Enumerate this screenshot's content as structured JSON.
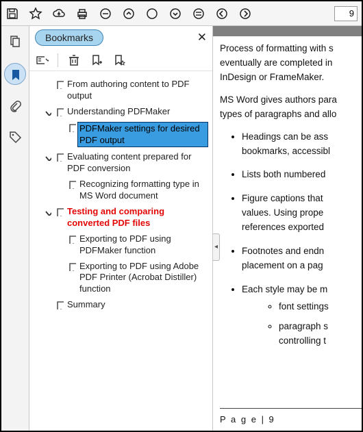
{
  "toolbar": {
    "page_value": "9"
  },
  "panel": {
    "title": "Bookmarks"
  },
  "bookmarks": [
    {
      "label": "From authoring content to PDF output",
      "level": 1,
      "twist": "",
      "style": ""
    },
    {
      "label": "Understanding PDFMaker",
      "level": 1,
      "twist": "down",
      "style": ""
    },
    {
      "label": "PDFMaker settings for desired PDF output",
      "level": 2,
      "twist": "",
      "style": "selected"
    },
    {
      "label": "Evaluating content prepared for PDF conversion",
      "level": 1,
      "twist": "down",
      "style": ""
    },
    {
      "label": "Recognizing formatting type in MS Word document",
      "level": 2,
      "twist": "",
      "style": ""
    },
    {
      "label": "Testing and comparing converted PDF files",
      "level": 1,
      "twist": "down",
      "style": "red"
    },
    {
      "label": "Exporting to PDF using PDFMaker function",
      "level": 2,
      "twist": "",
      "style": ""
    },
    {
      "label": "Exporting to PDF using Adobe PDF Printer (Acrobat Distiller) function",
      "level": 2,
      "twist": "",
      "style": ""
    },
    {
      "label": "Summary",
      "level": 1,
      "twist": "",
      "style": ""
    }
  ],
  "doc": {
    "p1": "Process of formatting with s",
    "p1b": "eventually are completed in",
    "p1c": "InDesign or FrameMaker.",
    "p2": "MS Word gives authors para",
    "p2b": "types of paragraphs and allo",
    "b1": "Headings can be ass",
    "b1b": "bookmarks, accessibl",
    "b2": "Lists both numbered",
    "b3": "Figure captions that",
    "b3b": "values. Using prope",
    "b3c": "references exported",
    "b4": "Footnotes and endn",
    "b4b": "placement on a pag",
    "b5": "Each style may be m",
    "s1": "font settings",
    "s2": "paragraph s",
    "s2b": "controlling t",
    "footer": "P a g e  | 9"
  }
}
